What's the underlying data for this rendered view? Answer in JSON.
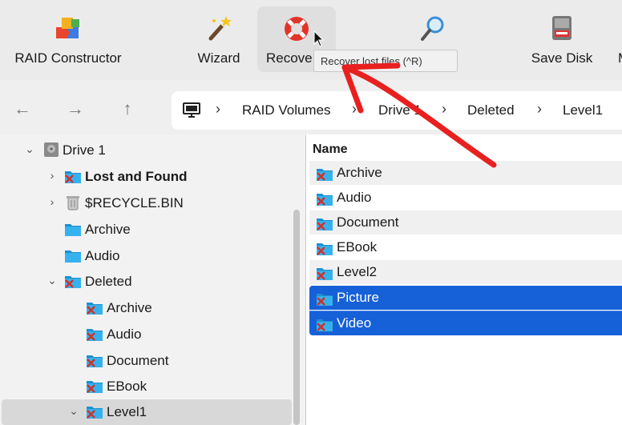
{
  "toolbar": {
    "raid_label": "RAID Constructor",
    "wizard_label": "Wizard",
    "recover_label": "Recove",
    "save_disk_label": "Save Disk",
    "more_label": "M",
    "tooltip": "Recover lost files (^R)"
  },
  "nav": {
    "back": "←",
    "forward": "→",
    "up": "↑",
    "crumbs": [
      "RAID Volumes",
      "Drive 1",
      "Deleted",
      "Level1"
    ]
  },
  "tree": {
    "items": [
      {
        "label": "Drive 1"
      },
      {
        "label": "Lost and Found"
      },
      {
        "label": "$RECYCLE.BIN"
      },
      {
        "label": "Archive"
      },
      {
        "label": "Audio"
      },
      {
        "label": "Deleted"
      },
      {
        "label": "Archive"
      },
      {
        "label": "Audio"
      },
      {
        "label": "Document"
      },
      {
        "label": "EBook"
      },
      {
        "label": "Level1"
      }
    ]
  },
  "list": {
    "header": "Name",
    "items": [
      {
        "label": "Archive"
      },
      {
        "label": "Audio"
      },
      {
        "label": "Document"
      },
      {
        "label": "EBook"
      },
      {
        "label": "Level2"
      },
      {
        "label": "Picture"
      },
      {
        "label": "Video"
      }
    ]
  },
  "colors": {
    "selection": "#1660d8",
    "folder": "#2aa7e6",
    "deleted_mark": "#d0302a",
    "annotation": "#e8201f"
  }
}
